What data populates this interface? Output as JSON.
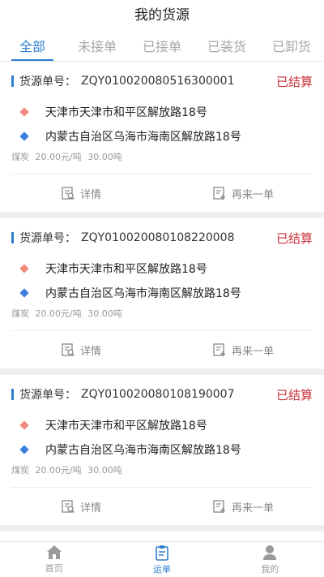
{
  "header": {
    "title": "我的货源"
  },
  "tabs": [
    {
      "label": "全部",
      "active": true
    },
    {
      "label": "未接单",
      "active": false
    },
    {
      "label": "已接单",
      "active": false
    },
    {
      "label": "已装货",
      "active": false
    },
    {
      "label": "已卸货",
      "active": false
    }
  ],
  "orders": [
    {
      "label": "货源单号：",
      "number": "ZQY010020080516300001",
      "status": "已结算",
      "from": "天津市天津市和平区解放路18号",
      "to": "内蒙古自治区乌海市海南区解放路18号",
      "cargo": "煤炭",
      "price": "20.00元/吨",
      "weight": "30.00吨",
      "detail_label": "详情",
      "reorder_label": "再来一单"
    },
    {
      "label": "货源单号：",
      "number": "ZQY010020080108220008",
      "status": "已结算",
      "from": "天津市天津市和平区解放路18号",
      "to": "内蒙古自治区乌海市海南区解放路18号",
      "cargo": "煤炭",
      "price": "20.00元/吨",
      "weight": "30.00吨",
      "detail_label": "详情",
      "reorder_label": "再来一单"
    },
    {
      "label": "货源单号：",
      "number": "ZQY010020080108190007",
      "status": "已结算",
      "from": "天津市天津市和平区解放路18号",
      "to": "内蒙古自治区乌海市海南区解放路18号",
      "cargo": "煤炭",
      "price": "20.00元/吨",
      "weight": "30.00吨",
      "detail_label": "详情",
      "reorder_label": "再来一单"
    }
  ],
  "tabbar": [
    {
      "label": "首页",
      "icon": "home-icon",
      "active": false
    },
    {
      "label": "运单",
      "icon": "waybill-icon",
      "active": true
    },
    {
      "label": "我的",
      "icon": "user-icon",
      "active": false
    }
  ],
  "colors": {
    "accent": "#2f7fd0",
    "status": "#c8323a",
    "from_marker": "#f08a7c",
    "to_marker": "#3b7ee0"
  }
}
